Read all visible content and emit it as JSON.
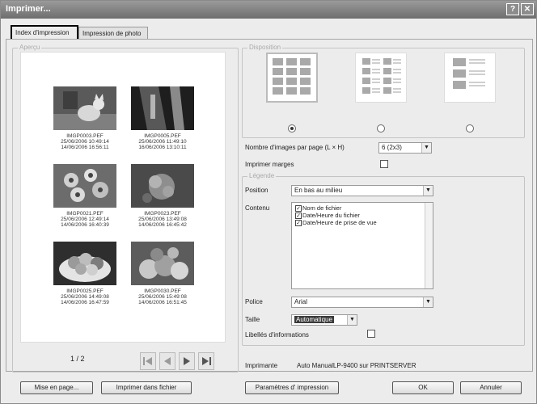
{
  "window": {
    "title": "Imprimer..."
  },
  "title_buttons": {
    "help": "?",
    "close": "✕"
  },
  "tabs": [
    {
      "label": "Index d'impression"
    },
    {
      "label": "Impression de photo"
    }
  ],
  "preview": {
    "title": "Aperçu",
    "page_indicator": "1 / 2",
    "images": [
      {
        "file": "IMGP0003.PEF",
        "date1": "25/06/2006 10:49:14",
        "date2": "14/06/2006 16:56:11"
      },
      {
        "file": "IMGP0005.PEF",
        "date1": "25/06/2006 11:49:10",
        "date2": "16/06/2006 13:10:11"
      },
      {
        "file": "IMGP0021.PEF",
        "date1": "25/06/2006 12:49:14",
        "date2": "14/06/2006 16:40:39"
      },
      {
        "file": "IMGP0023.PEF",
        "date1": "25/06/2006 13:49:08",
        "date2": "14/06/2006 16:45:42"
      },
      {
        "file": "IMGP0025.PEF",
        "date1": "25/06/2006 14:49:08",
        "date2": "14/06/2006 16:47:59"
      },
      {
        "file": "IMGP0030.PEF",
        "date1": "25/06/2006 15:49:08",
        "date2": "14/06/2006 16:51:45"
      }
    ],
    "nav_icons": [
      "first-page-icon",
      "previous-page-icon",
      "next-page-icon",
      "last-page-icon"
    ]
  },
  "disposition": {
    "title": "Disposition",
    "selected_layout": 0,
    "images_per_page_label": "Nombre d'images par page (L × H)",
    "images_per_page_value": "6 (2x3)",
    "print_margins_label": "Imprimer marges",
    "print_margins_checked": false
  },
  "legende": {
    "title": "Légende",
    "position_label": "Position",
    "position_value": "En bas au milieu",
    "contenu_label": "Contenu",
    "contenu_items": [
      {
        "label": "Nom de fichier",
        "checked": true
      },
      {
        "label": "Date/Heure du fichier",
        "checked": true
      },
      {
        "label": "Date/Heure de prise de vue",
        "checked": true
      }
    ],
    "police_label": "Police",
    "police_value": "Arial",
    "taille_label": "Taille",
    "taille_value": "Automatique",
    "libelles_label": "Libellés d'informations",
    "libelles_checked": false
  },
  "printer": {
    "label": "Imprimante",
    "value": "Auto ManualLP-9400 sur PRINTSERVER"
  },
  "buttons": {
    "mise_en_page": "Mise en page...",
    "imprimer_fichier": "Imprimer dans fichier",
    "parametres": "Paramètres d' impression",
    "ok": "OK",
    "annuler": "Annuler"
  }
}
